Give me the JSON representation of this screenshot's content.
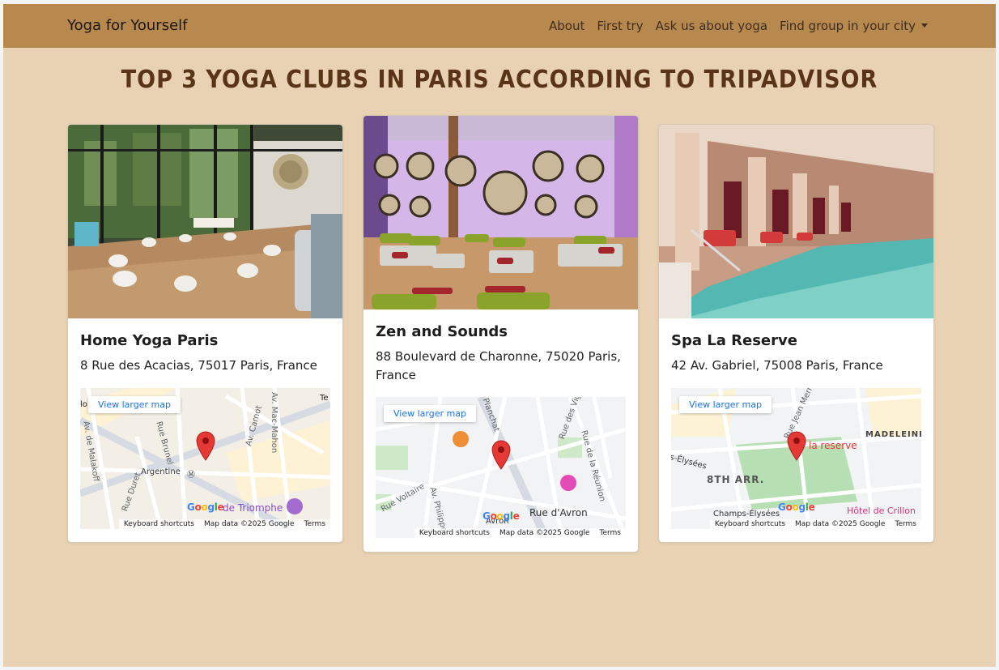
{
  "navbar": {
    "brand": "Yoga for Yourself",
    "links": [
      "About",
      "First try",
      "Ask us about yoga",
      "Find group in your city"
    ]
  },
  "page": {
    "title": "TOP 3 YOGA CLUBS IN PARIS ACCORDING TO TRIPADVISOR"
  },
  "clubs": [
    {
      "name": "Home Yoga Paris",
      "address": "8 Rue des Acacias, 75017 Paris, France",
      "map": {
        "button": "View larger map",
        "labels": [
          "Argentine",
          "Rue Brunel",
          "Av. de Malakoff",
          "Rue Duret",
          "Av. Carnot",
          "Av. Mac-Mahon",
          "de Triomphe",
          "lo",
          "Te"
        ]
      }
    },
    {
      "name": "Zen and Sounds",
      "address": "88 Boulevard de Charonne, 75020 Paris, France",
      "map": {
        "button": "View larger map",
        "labels": [
          "Planchat",
          "Rue des Vignoles",
          "Rue de la Réunion",
          "Rue Voltaire",
          "Av. Philippe",
          "Rue d'Avron",
          "Avron"
        ]
      }
    },
    {
      "name": "Spa La Reserve",
      "address": "42 Av. Gabriel, 75008 Paris, France",
      "map": {
        "button": "View larger map",
        "labels": [
          "la reserve",
          "MADELEINE",
          "8TH ARR.",
          "Champs-Élysées",
          "Hôtel de Crillon",
          "s-Élysées",
          "Rue Jean Mermoz"
        ]
      }
    }
  ],
  "map_common": {
    "logo": [
      "G",
      "o",
      "o",
      "g",
      "l",
      "e"
    ],
    "footer": [
      "Keyboard shortcuts",
      "Map data ©2025 Google",
      "Terms"
    ]
  },
  "colors": {
    "navbar": "#b7894f",
    "background": "#e8d2b3",
    "title": "#5a3417",
    "map_pin": "#e53935",
    "map_link": "#1a73e8"
  },
  "icons": [
    "map-pin-icon",
    "caret-down-icon",
    "metro-icon",
    "restaurant-icon",
    "hotel-icon",
    "monument-icon"
  ]
}
